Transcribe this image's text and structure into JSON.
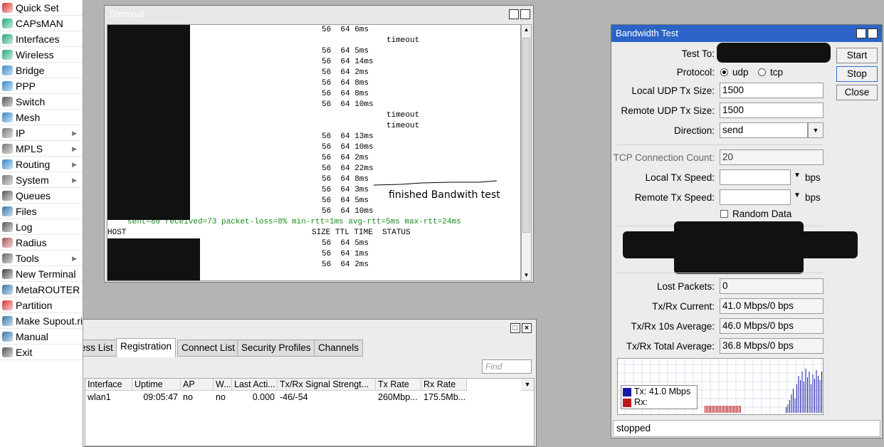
{
  "sidebar": {
    "items": [
      {
        "label": "Quick Set",
        "icon": "quick-set-icon",
        "sub": false
      },
      {
        "label": "CAPsMAN",
        "icon": "capsman-icon",
        "sub": false
      },
      {
        "label": "Interfaces",
        "icon": "interfaces-icon",
        "sub": false
      },
      {
        "label": "Wireless",
        "icon": "wireless-icon",
        "sub": false
      },
      {
        "label": "Bridge",
        "icon": "bridge-icon",
        "sub": false
      },
      {
        "label": "PPP",
        "icon": "ppp-icon",
        "sub": false
      },
      {
        "label": "Switch",
        "icon": "switch-icon",
        "sub": false
      },
      {
        "label": "Mesh",
        "icon": "mesh-icon",
        "sub": false
      },
      {
        "label": "IP",
        "icon": "ip-icon",
        "sub": true
      },
      {
        "label": "MPLS",
        "icon": "mpls-icon",
        "sub": true
      },
      {
        "label": "Routing",
        "icon": "routing-icon",
        "sub": true
      },
      {
        "label": "System",
        "icon": "system-icon",
        "sub": true
      },
      {
        "label": "Queues",
        "icon": "queues-icon",
        "sub": false
      },
      {
        "label": "Files",
        "icon": "files-icon",
        "sub": false
      },
      {
        "label": "Log",
        "icon": "log-icon",
        "sub": false
      },
      {
        "label": "Radius",
        "icon": "radius-icon",
        "sub": false
      },
      {
        "label": "Tools",
        "icon": "tools-icon",
        "sub": true
      },
      {
        "label": "New Terminal",
        "icon": "terminal-icon",
        "sub": false
      },
      {
        "label": "MetaROUTER",
        "icon": "metarouter-icon",
        "sub": false
      },
      {
        "label": "Partition",
        "icon": "partition-icon",
        "sub": false
      },
      {
        "label": "Make Supout.rif",
        "icon": "supout-icon",
        "sub": false
      },
      {
        "label": "Manual",
        "icon": "manual-icon",
        "sub": false
      },
      {
        "label": "Exit",
        "icon": "exit-icon",
        "sub": false
      }
    ]
  },
  "terminal": {
    "title": "Terminal",
    "ping_lines": [
      {
        "text": "56  64 6ms",
        "kind": "ping"
      },
      {
        "text": "timeout",
        "kind": "timeout"
      },
      {
        "text": "56  64 5ms",
        "kind": "ping"
      },
      {
        "text": "56  64 14ms",
        "kind": "ping"
      },
      {
        "text": "56  64 2ms",
        "kind": "ping"
      },
      {
        "text": "56  64 8ms",
        "kind": "ping"
      },
      {
        "text": "56  64 8ms",
        "kind": "ping"
      },
      {
        "text": "56  64 10ms",
        "kind": "ping"
      },
      {
        "text": "timeout",
        "kind": "timeout"
      },
      {
        "text": "timeout",
        "kind": "timeout"
      },
      {
        "text": "56  64 13ms",
        "kind": "ping"
      },
      {
        "text": "56  64 10ms",
        "kind": "ping"
      },
      {
        "text": "56  64 2ms",
        "kind": "ping"
      },
      {
        "text": "56  64 22ms",
        "kind": "ping"
      },
      {
        "text": "56  64 8ms",
        "kind": "ping"
      },
      {
        "text": "56  64 3ms",
        "kind": "ping"
      },
      {
        "text": "56  64 5ms",
        "kind": "ping"
      },
      {
        "text": "56  64 10ms",
        "kind": "ping"
      }
    ],
    "summary": "sent=80 received=73 packet-loss=8% min-rtt=1ms avg-rtt=5ms max-rtt=24ms",
    "header_host": "HOST",
    "header_cols": "SIZE TTL TIME  STATUS",
    "tail_lines": [
      "56  64 5ms",
      "56  64 1ms",
      "56  64 2ms"
    ],
    "annotation": "finished Bandwith test"
  },
  "wireless": {
    "tabs": [
      "ess List",
      "Registration",
      "Connect List",
      "Security Profiles",
      "Channels"
    ],
    "active_tab": 1,
    "find_placeholder": "Find",
    "columns": [
      "Interface",
      "Uptime",
      "AP",
      "W...",
      "Last Acti...",
      "Tx/Rx Signal Strengt...",
      "Tx Rate",
      "Rx Rate"
    ],
    "rows": [
      [
        "wlan1",
        "09:05:47",
        "no",
        "no",
        "0.000",
        "-46/-54",
        "260Mbp...",
        "175.5Mb..."
      ]
    ]
  },
  "bandwidth_test": {
    "title": "Bandwidth Test",
    "buttons": {
      "start": "Start",
      "stop": "Stop",
      "close": "Close"
    },
    "test_to_label": "Test To:",
    "protocol_label": "Protocol:",
    "protocol_udp": "udp",
    "protocol_tcp": "tcp",
    "protocol_selected": "udp",
    "local_udp_label": "Local UDP Tx Size:",
    "local_udp_value": "1500",
    "remote_udp_label": "Remote UDP Tx Size:",
    "remote_udp_value": "1500",
    "direction_label": "Direction:",
    "direction_value": "send",
    "tcp_conn_label": "TCP Connection Count:",
    "tcp_conn_value": "20",
    "local_speed_label": "Local Tx Speed:",
    "remote_speed_label": "Remote Tx Speed:",
    "speed_unit": "bps",
    "random_data_label": "Random Data",
    "lost_packets_label": "Lost Packets:",
    "lost_packets_value": "0",
    "current_label": "Tx/Rx Current:",
    "current_value": "41.0 Mbps/0 bps",
    "avg10_label": "Tx/Rx 10s Average:",
    "avg10_value": "46.0 Mbps/0 bps",
    "total_label": "Tx/Rx Total Average:",
    "total_value": "36.8 Mbps/0 bps",
    "legend_tx": "Tx:  41.0 Mbps",
    "legend_rx": "Rx:",
    "status": "stopped",
    "colors": {
      "tx": "#1a1aa8",
      "rx": "#b81818",
      "title": "#2b64c6"
    }
  }
}
